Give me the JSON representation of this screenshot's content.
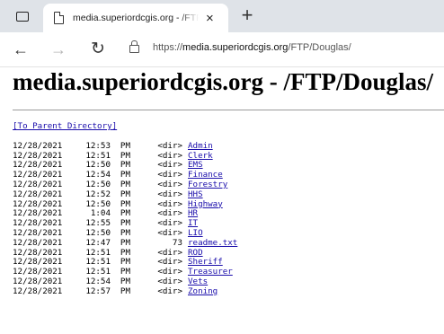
{
  "browser": {
    "tab_title": "media.superiordcgis.org - /FTP/Douglas/",
    "tab_close": "×",
    "new_tab": "+",
    "url_prefix": "https://",
    "url_host": "media.superiordcgis.org",
    "url_path": "/FTP/Douglas/"
  },
  "page": {
    "title": "media.superiordcgis.org - /FTP/Douglas/",
    "parent_link": "[To Parent Directory]"
  },
  "entries": [
    {
      "date": "12/28/2021",
      "time": "12:53",
      "ampm": "PM",
      "size": "<dir>",
      "name": "Admin"
    },
    {
      "date": "12/28/2021",
      "time": "12:51",
      "ampm": "PM",
      "size": "<dir>",
      "name": "Clerk"
    },
    {
      "date": "12/28/2021",
      "time": "12:50",
      "ampm": "PM",
      "size": "<dir>",
      "name": "EMS"
    },
    {
      "date": "12/28/2021",
      "time": "12:54",
      "ampm": "PM",
      "size": "<dir>",
      "name": "Finance"
    },
    {
      "date": "12/28/2021",
      "time": "12:50",
      "ampm": "PM",
      "size": "<dir>",
      "name": "Forestry"
    },
    {
      "date": "12/28/2021",
      "time": "12:52",
      "ampm": "PM",
      "size": "<dir>",
      "name": "HHS"
    },
    {
      "date": "12/28/2021",
      "time": "12:50",
      "ampm": "PM",
      "size": "<dir>",
      "name": "Highway"
    },
    {
      "date": "12/28/2021",
      "time": "1:04",
      "ampm": "PM",
      "size": "<dir>",
      "name": "HR"
    },
    {
      "date": "12/28/2021",
      "time": "12:55",
      "ampm": "PM",
      "size": "<dir>",
      "name": "IT"
    },
    {
      "date": "12/28/2021",
      "time": "12:50",
      "ampm": "PM",
      "size": "<dir>",
      "name": "LIO"
    },
    {
      "date": "12/28/2021",
      "time": "12:47",
      "ampm": "PM",
      "size": "73",
      "name": "readme.txt"
    },
    {
      "date": "12/28/2021",
      "time": "12:51",
      "ampm": "PM",
      "size": "<dir>",
      "name": "ROD"
    },
    {
      "date": "12/28/2021",
      "time": "12:51",
      "ampm": "PM",
      "size": "<dir>",
      "name": "Sheriff"
    },
    {
      "date": "12/28/2021",
      "time": "12:51",
      "ampm": "PM",
      "size": "<dir>",
      "name": "Treasurer"
    },
    {
      "date": "12/28/2021",
      "time": "12:54",
      "ampm": "PM",
      "size": "<dir>",
      "name": "Vets"
    },
    {
      "date": "12/28/2021",
      "time": "12:57",
      "ampm": "PM",
      "size": "<dir>",
      "name": "Zoning"
    }
  ]
}
